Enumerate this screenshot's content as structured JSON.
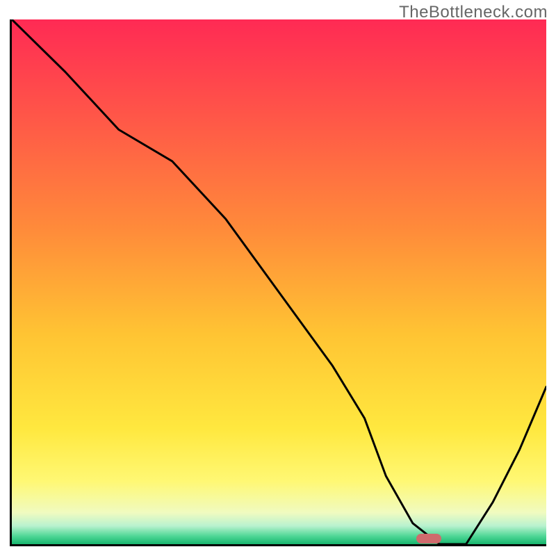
{
  "watermark": "TheBottleneck.com",
  "chart_data": {
    "type": "line",
    "title": "",
    "xlabel": "",
    "ylabel": "",
    "xlim": [
      0,
      100
    ],
    "ylim": [
      0,
      100
    ],
    "grid": false,
    "legend": false,
    "x": [
      0,
      10,
      20,
      30,
      40,
      50,
      60,
      66,
      70,
      75,
      80,
      85,
      90,
      95,
      100
    ],
    "values": [
      100,
      90,
      79,
      73,
      62,
      48,
      34,
      24,
      13,
      4,
      0,
      0,
      8,
      18,
      30
    ],
    "marker": {
      "x": 78,
      "y": 1,
      "shape": "pill",
      "color": "#cf6b6d"
    },
    "gradient_stops": [
      {
        "t": 0.0,
        "color": "#ff2a54"
      },
      {
        "t": 0.2,
        "color": "#ff5a47"
      },
      {
        "t": 0.4,
        "color": "#ff8b3a"
      },
      {
        "t": 0.6,
        "color": "#ffc433"
      },
      {
        "t": 0.78,
        "color": "#ffe83f"
      },
      {
        "t": 0.88,
        "color": "#fff874"
      },
      {
        "t": 0.94,
        "color": "#f0fbc0"
      },
      {
        "t": 0.965,
        "color": "#b9f2cf"
      },
      {
        "t": 0.985,
        "color": "#4dd695"
      },
      {
        "t": 1.0,
        "color": "#18b66e"
      }
    ]
  }
}
